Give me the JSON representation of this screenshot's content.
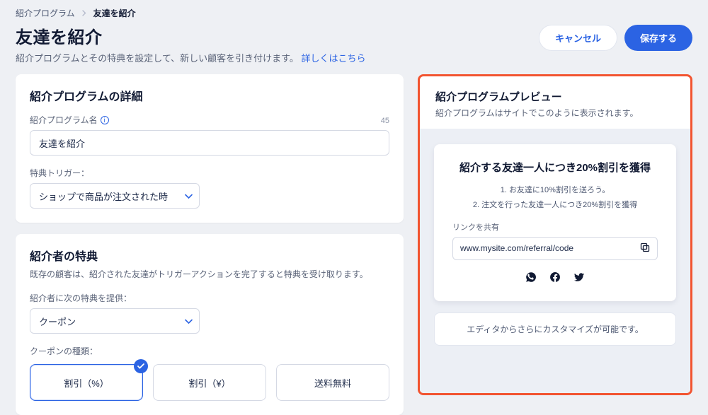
{
  "breadcrumb": {
    "parent": "紹介プログラム",
    "current": "友達を紹介"
  },
  "header": {
    "title": "友達を紹介",
    "subtitle_prefix": "紹介プログラムとその特典を設定して、新しい顧客を引き付けます。",
    "subtitle_link": "詳しくはこちら",
    "cancel": "キャンセル",
    "save": "保存する"
  },
  "details": {
    "card_title": "紹介プログラムの詳細",
    "name_label": "紹介プログラム名",
    "name_value": "友達を紹介",
    "name_count": "45",
    "trigger_label": "特典トリガー：",
    "trigger_value": "ショップで商品が注文された時"
  },
  "reward": {
    "card_title": "紹介者の特典",
    "desc": "既存の顧客は、紹介された友達がトリガーアクションを完了すると特典を受け取ります。",
    "provide_label": "紹介者に次の特典を提供：",
    "provide_value": "クーポン",
    "coupon_type_label": "クーポンの種類：",
    "options": [
      {
        "label": "割引（%）",
        "selected": true
      },
      {
        "label": "割引（¥）",
        "selected": false
      },
      {
        "label": "送料無料",
        "selected": false
      }
    ]
  },
  "preview": {
    "title": "紹介プログラムプレビュー",
    "subtitle": "紹介プログラムはサイトでこのように表示されます。",
    "widget_title": "紹介する友達一人につき20%割引を獲得",
    "step1": "1. お友達に10%割引を送ろう。",
    "step2": "2. 注文を行った友達一人につき20%割引を獲得",
    "share_label": "リンクを共有",
    "url": "www.mysite.com/referral/code",
    "editor_note": "エディタからさらにカスタマイズが可能です。"
  }
}
